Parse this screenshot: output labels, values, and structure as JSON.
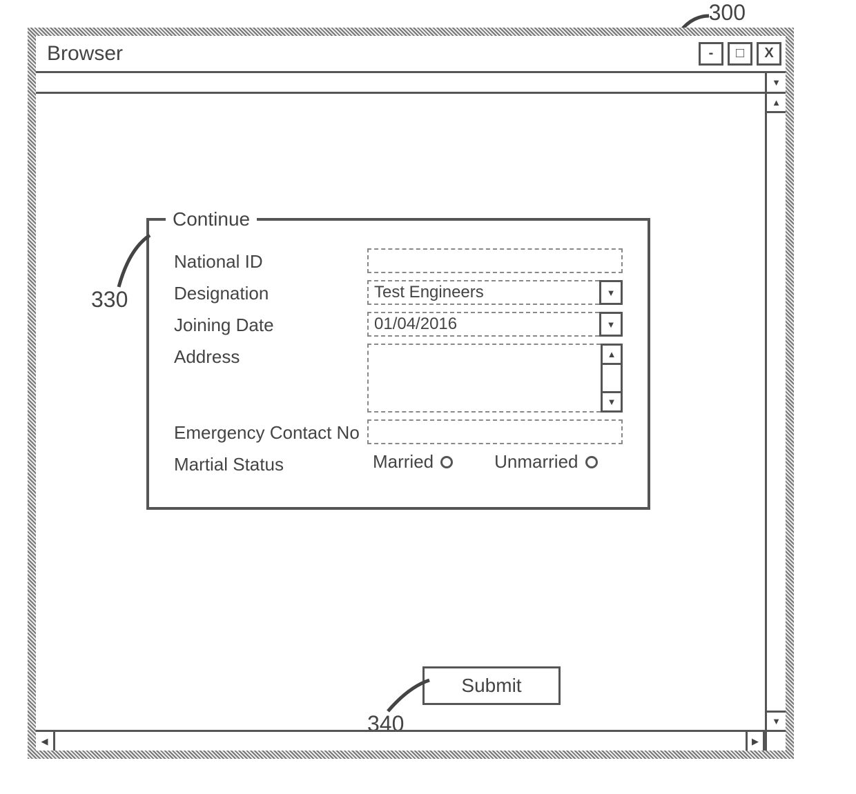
{
  "callouts": {
    "window": "300",
    "fieldset": "330",
    "submit": "340"
  },
  "window": {
    "title": "Browser",
    "controls": {
      "minimize": "-",
      "maximize": "□",
      "close": "X"
    }
  },
  "form": {
    "legend": "Continue",
    "fields": {
      "national_id": {
        "label": "National ID",
        "value": ""
      },
      "designation": {
        "label": "Designation",
        "value": "Test Engineers"
      },
      "joining_date": {
        "label": "Joining Date",
        "value": "01/04/2016"
      },
      "address": {
        "label": "Address",
        "value": ""
      },
      "emergency": {
        "label": "Emergency Contact No",
        "value": ""
      },
      "marital": {
        "label": "Martial Status",
        "option1": "Married",
        "option2": "Unmarried"
      }
    },
    "submit_label": "Submit"
  }
}
